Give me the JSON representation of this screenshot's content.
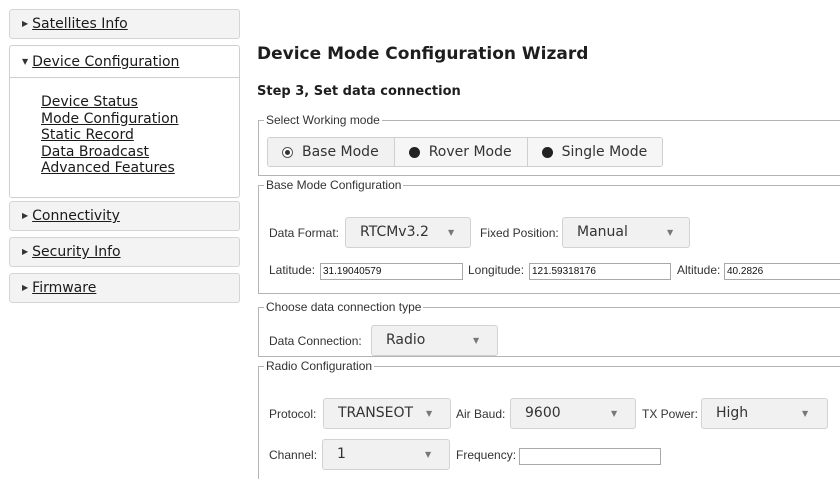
{
  "sidebar": {
    "sections": [
      {
        "label": "Satellites Info"
      },
      {
        "label": "Device Configuration"
      },
      {
        "label": "Connectivity"
      },
      {
        "label": "Security Info"
      },
      {
        "label": "Firmware"
      }
    ],
    "device_config_items": [
      {
        "label": "Device Status"
      },
      {
        "label": "Mode Configuration"
      },
      {
        "label": "Static Record"
      },
      {
        "label": "Data Broadcast"
      },
      {
        "label": "Advanced Features"
      }
    ]
  },
  "main": {
    "title": "Device Mode Configuration Wizard",
    "step": "Step 3, Set data connection",
    "working_mode": {
      "legend": "Select Working mode",
      "options": [
        {
          "label": "Base Mode",
          "selected": true
        },
        {
          "label": "Rover Mode",
          "selected": false
        },
        {
          "label": "Single Mode",
          "selected": false
        }
      ]
    },
    "base_config": {
      "legend": "Base Mode Configuration",
      "data_format_label": "Data Format:",
      "data_format_value": "RTCMv3.2",
      "fixed_position_label": "Fixed Position:",
      "fixed_position_value": "Manual",
      "latitude_label": "Latitude:",
      "latitude_value": "31.19040579",
      "longitude_label": "Longitude:",
      "longitude_value": "121.59318176",
      "altitude_label": "Altitude:",
      "altitude_value": "40.2826"
    },
    "connection_type": {
      "legend": "Choose data connection type",
      "data_connection_label": "Data Connection:",
      "data_connection_value": "Radio"
    },
    "radio_config": {
      "legend": "Radio Configuration",
      "protocol_label": "Protocol:",
      "protocol_value": "TRANSEOT",
      "air_baud_label": "Air Baud:",
      "air_baud_value": "9600",
      "tx_power_label": "TX Power:",
      "tx_power_value": "High",
      "channel_label": "Channel:",
      "channel_value": "1",
      "frequency_label": "Frequency:",
      "frequency_value": ""
    }
  },
  "icons": {
    "collapsed": "caret-right-icon",
    "expanded": "caret-down-icon",
    "dropdown": "dropdown-arrow-icon",
    "radio_on": "radio-selected-icon",
    "radio_off": "radio-unselected-icon"
  }
}
